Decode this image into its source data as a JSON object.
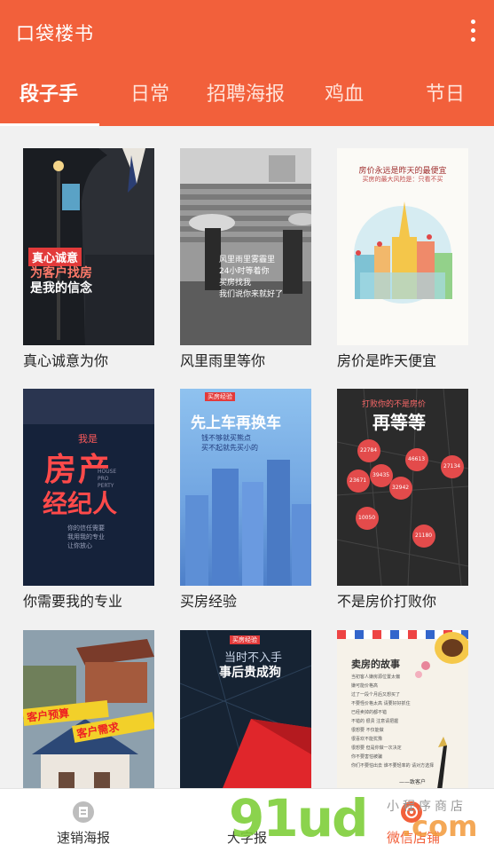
{
  "app": {
    "title": "口袋楼书",
    "more_icon": "more-vert-icon"
  },
  "tabs": [
    {
      "label": "段子手",
      "active": true
    },
    {
      "label": "日常",
      "active": false
    },
    {
      "label": "招聘海报",
      "active": false
    },
    {
      "label": "鸡血",
      "active": false
    },
    {
      "label": "节日",
      "active": false
    }
  ],
  "posters": [
    {
      "label": "真心诚意为你",
      "texts": [
        "真心诚意",
        "为客户找房",
        "是我的信念"
      ]
    },
    {
      "label": "风里雨里等你",
      "texts": [
        "风里雨里雾霾里",
        "24小时等着你",
        "买房找我",
        "我们说你来就好了"
      ]
    },
    {
      "label": "房价是昨天便宜",
      "texts": [
        "房价永远是昨天的最便宜",
        "买房的最大风险是：只看不买"
      ]
    },
    {
      "label": "你需要我的专业",
      "texts": [
        "我是",
        "房产",
        "经纪人",
        "HOUSE",
        "PRO",
        "PERTY",
        "你的信任需要",
        "我用我的专业",
        "让你放心"
      ]
    },
    {
      "label": "买房经验",
      "texts": [
        "买房经验",
        "先上车再换车",
        "钱不够就买熊点",
        "买不起就先买小的"
      ]
    },
    {
      "label": "不是房价打败你",
      "texts": [
        "打败你的不是房价",
        "再等等",
        "22784",
        "46613",
        "27134",
        "39435",
        "32942",
        "23671",
        "10050",
        "21180"
      ]
    },
    {
      "label": "",
      "texts": [
        "客户预算",
        "客户需求"
      ]
    },
    {
      "label": "",
      "texts": [
        "买房经验",
        "当时不入手",
        "事后贵成狗"
      ]
    },
    {
      "label": "",
      "texts": [
        "卖房的故事",
        "当初客人嫌房源位置太偏",
        "嫌可能价格高",
        "过了一段个月后又想买了",
        "不要怪价格太高 请要好好抓住",
        "已经卖掉的都不错",
        "不错的 很贵  注意请把握",
        "很想要 不仅能做",
        "很喜欢不能犹豫",
        "很想要 但是你做一次决定",
        "你不要害怕被骗",
        "你们不要怕出去 谁不要轻率的 请对方选择",
        "——致客户"
      ]
    }
  ],
  "bottom_nav": [
    {
      "label": "速销海报",
      "icon": "poster-icon"
    },
    {
      "label": "大字报",
      "icon": ""
    },
    {
      "label": "微信店铺",
      "icon": "aperture-icon"
    }
  ],
  "watermark": {
    "logo": "91ud",
    "com": ".com",
    "store": "小程序商店"
  }
}
